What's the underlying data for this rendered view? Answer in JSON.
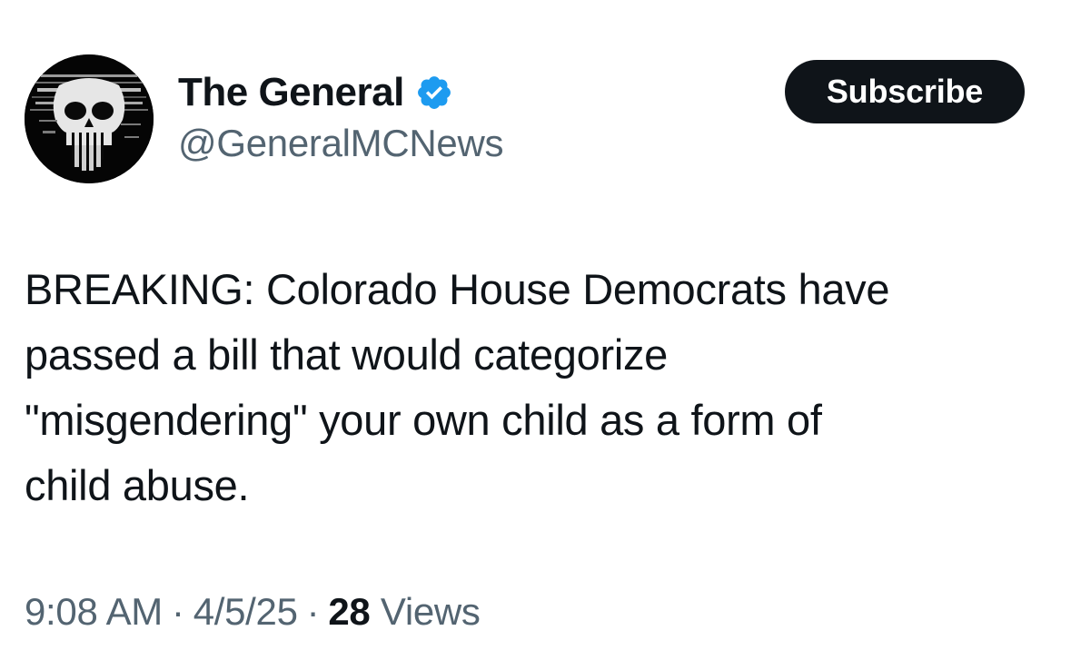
{
  "author": {
    "display_name": "The General",
    "handle": "@GeneralMCNews",
    "verified": true,
    "verified_color": "#1d9bf0",
    "avatar_icon": "punisher-skull-icon"
  },
  "actions": {
    "subscribe_label": "Subscribe"
  },
  "tweet": {
    "lines": [
      "BREAKING: Colorado House Democrats have",
      "passed a bill that would categorize",
      "\"misgendering\" your own child as a form of",
      "child abuse."
    ]
  },
  "meta": {
    "time": "9:08 AM",
    "separator": "·",
    "date": "4/5/25",
    "views_count": "28",
    "views_label": "Views"
  },
  "colors": {
    "text_primary": "#0f1419",
    "text_secondary": "#536471",
    "button_bg": "#0f1419",
    "button_text": "#ffffff"
  }
}
